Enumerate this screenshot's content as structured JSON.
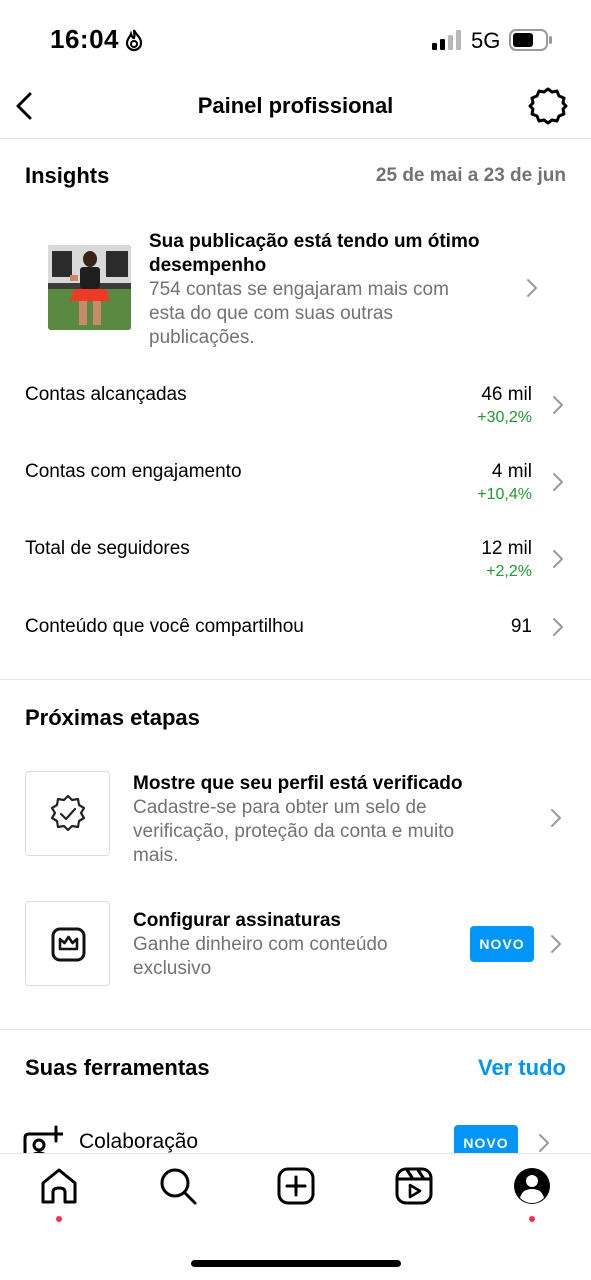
{
  "status_bar": {
    "time": "16:04",
    "network": "5G"
  },
  "header": {
    "title": "Painel profissional"
  },
  "insights": {
    "title": "Insights",
    "date_range": "25 de mai a 23 de jun",
    "featured_post": {
      "title_line1": "Sua publicação está tendo um ótimo",
      "title_line2": "desempenho",
      "desc_line1": "754 contas se engajaram mais com",
      "desc_line2": "esta do que com suas outras",
      "desc_line3": "publicações."
    },
    "metrics": [
      {
        "label": "Contas alcançadas",
        "value": "46 mil",
        "change": "+30,2%"
      },
      {
        "label": "Contas com engajamento",
        "value": "4 mil",
        "change": "+10,4%"
      },
      {
        "label": "Total de seguidores",
        "value": "12 mil",
        "change": "+2,2%"
      },
      {
        "label": "Conteúdo que você compartilhou",
        "value": "91",
        "change": ""
      }
    ]
  },
  "next_steps": {
    "title": "Próximas etapas",
    "items": [
      {
        "title": "Mostre que seu perfil está verificado",
        "desc_line1": "Cadastre-se para obter um selo de",
        "desc_line2": "verificação, proteção da conta e muito",
        "desc_line3": "mais."
      },
      {
        "title": "Configurar assinaturas",
        "desc_line1": "Ganhe dinheiro com conteúdo",
        "desc_line2": "exclusivo",
        "badge": "NOVO"
      }
    ]
  },
  "tools": {
    "title": "Suas ferramentas",
    "see_all": "Ver tudo",
    "items": [
      {
        "label": "Colaboração",
        "badge": "NOVO"
      }
    ]
  },
  "colors": {
    "accent": "#0095f6",
    "positive": "#1a9b2e",
    "secondary_text": "#737373",
    "notification_dot": "#ff2c55"
  },
  "icons": [
    "flame-icon",
    "signal-icon",
    "battery-icon",
    "back-arrow-icon",
    "settings-gear-icon",
    "verified-badge-icon",
    "subscription-crown-icon",
    "add-collaborator-icon",
    "home-icon",
    "search-icon",
    "create-icon",
    "reels-icon",
    "profile-icon"
  ]
}
